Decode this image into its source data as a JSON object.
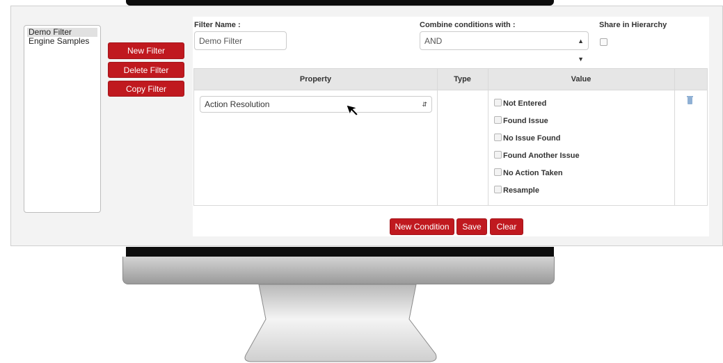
{
  "filters_list": {
    "items": [
      "Demo Filter",
      "Engine Samples"
    ],
    "selected_index": 0
  },
  "buttons": {
    "new_filter": "New Filter",
    "delete_filter": "Delete Filter",
    "copy_filter": "Copy Filter",
    "new_condition": "New Condition",
    "save": "Save",
    "clear": "Clear"
  },
  "form": {
    "filter_name_label": "Filter Name :",
    "filter_name_value": "Demo Filter",
    "combine_label": "Combine conditions with :",
    "combine_value": "AND",
    "share_label": "Share in Hierarchy",
    "share_checked": false
  },
  "table": {
    "headers": [
      "Property",
      "Type",
      "Value"
    ],
    "row": {
      "property": "Action Resolution",
      "type": "",
      "values": [
        "Not Entered",
        "Found Issue",
        "No Issue Found",
        "Found Another Issue",
        "No Action Taken",
        "Resample"
      ]
    }
  },
  "colors": {
    "accent_red": "#c0191f",
    "header_gray": "#e6e6e6",
    "trash_blue": "#8fb0d4"
  },
  "icons": [
    "select-arrow-icon",
    "trash-icon",
    "mouse-cursor-icon"
  ]
}
